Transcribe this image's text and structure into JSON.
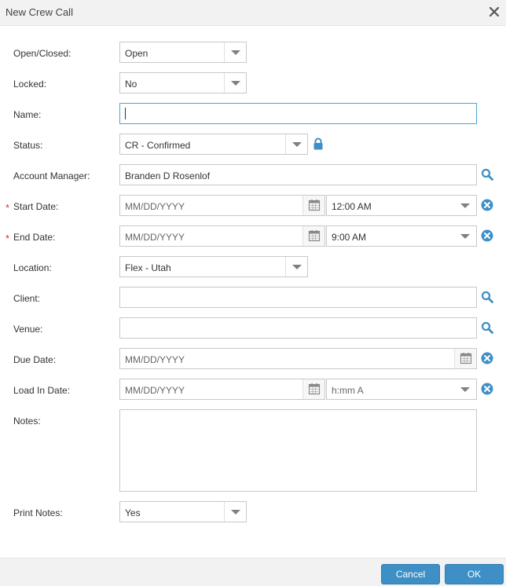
{
  "dialog": {
    "title": "New Crew Call"
  },
  "fields": {
    "open_closed": {
      "label": "Open/Closed:",
      "value": "Open"
    },
    "locked": {
      "label": "Locked:",
      "value": "No"
    },
    "name": {
      "label": "Name:",
      "value": ""
    },
    "status": {
      "label": "Status:",
      "value": "CR - Confirmed"
    },
    "account_manager": {
      "label": "Account Manager:",
      "value": "Branden D Rosenlof"
    },
    "start_date": {
      "label": "Start Date:",
      "required": "*",
      "date_placeholder": "MM/DD/YYYY",
      "time_value": "12:00 AM"
    },
    "end_date": {
      "label": "End Date:",
      "required": "*",
      "date_placeholder": "MM/DD/YYYY",
      "time_value": "9:00 AM"
    },
    "location": {
      "label": "Location:",
      "value": "Flex - Utah"
    },
    "client": {
      "label": "Client:",
      "value": ""
    },
    "venue": {
      "label": "Venue:",
      "value": ""
    },
    "due_date": {
      "label": "Due Date:",
      "date_placeholder": "MM/DD/YYYY"
    },
    "load_in_date": {
      "label": "Load In Date:",
      "date_placeholder": "MM/DD/YYYY",
      "time_placeholder": "h:mm A"
    },
    "notes": {
      "label": "Notes:",
      "value": ""
    },
    "print_notes": {
      "label": "Print Notes:",
      "value": "Yes"
    }
  },
  "buttons": {
    "cancel": "Cancel",
    "ok": "OK"
  },
  "icons": {
    "close": "close-icon",
    "lock": "lock-icon",
    "search": "search-icon",
    "clear": "clear-circle-icon",
    "calendar": "calendar-icon",
    "dropdown": "chevron-down-icon"
  },
  "colors": {
    "accent": "#3d8fc6",
    "required": "#d9302c",
    "focus_border": "#4aa3d9"
  }
}
